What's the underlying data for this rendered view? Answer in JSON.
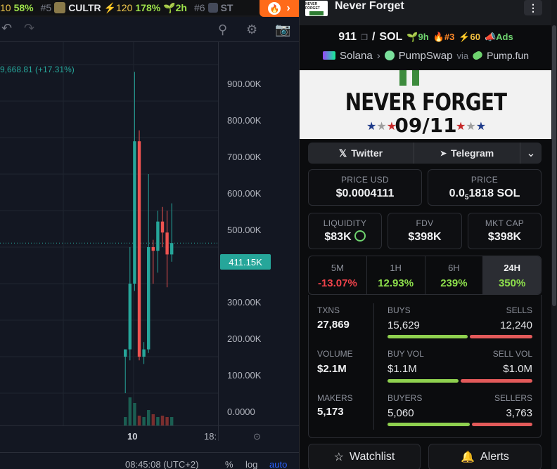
{
  "ticker": {
    "items": [
      {
        "rank": "10",
        "pct": "58%"
      },
      {
        "rank": "#5",
        "sym": "CULTR",
        "boost": "⚡120",
        "pct": "178%",
        "age": "2h"
      },
      {
        "rank": "#6",
        "sym": "ST"
      }
    ]
  },
  "chart": {
    "change_label": "9,668.81 (+17.31%)",
    "yticks": [
      "900.00K",
      "800.00K",
      "700.00K",
      "600.00K",
      "500.00K",
      "300.00K",
      "200.00K",
      "100.00K",
      "0.0000"
    ],
    "current_price": "411.15K",
    "xticks": [
      "10",
      "18:"
    ],
    "status": {
      "time": "08:45:08 (UTC+2)",
      "pct": "%",
      "log": "log",
      "auto": "auto"
    }
  },
  "chart_data": {
    "type": "candlestick",
    "y_unit": "market cap",
    "current": 411150,
    "ylim": [
      0,
      1000000
    ],
    "candles": [
      {
        "o": 100000,
        "h": 120000,
        "l": 0,
        "c": 120000
      },
      {
        "o": 120000,
        "h": 400000,
        "l": 90000,
        "c": 300000
      },
      {
        "o": 300000,
        "h": 880000,
        "l": 280000,
        "c": 690000
      },
      {
        "o": 690000,
        "h": 720000,
        "l": 90000,
        "c": 100000
      },
      {
        "o": 100000,
        "h": 140000,
        "l": 80000,
        "c": 120000
      },
      {
        "o": 120000,
        "h": 600000,
        "l": 110000,
        "c": 400000
      },
      {
        "o": 400000,
        "h": 420000,
        "l": 300000,
        "c": 390000
      },
      {
        "o": 390000,
        "h": 500000,
        "l": 330000,
        "c": 470000
      },
      {
        "o": 470000,
        "h": 510000,
        "l": 400000,
        "c": 440000
      },
      {
        "o": 440000,
        "h": 500000,
        "l": 290000,
        "c": 380000
      },
      {
        "o": 380000,
        "h": 520000,
        "l": 360000,
        "c": 411150
      }
    ],
    "volumes": [
      0.3,
      1,
      0.8,
      0.35,
      0.3,
      0.55,
      0.4,
      0.3,
      0.35,
      0.3,
      0.3
    ]
  },
  "panel": {
    "title": "Never Forget",
    "logo_text": "NEVER FORGET",
    "pair_symbol": "911",
    "pair_quote": "SOL",
    "age": "9h",
    "rank": "#3",
    "boost": "60",
    "ads": "Ads",
    "chain": "Solana",
    "dex": "PumpSwap",
    "via": "via",
    "launchpad": "Pump.fun",
    "banner_title": "NEVER FORGET",
    "banner_date": "09/11",
    "twitter": "Twitter",
    "telegram": "Telegram",
    "price_usd_label": "PRICE USD",
    "price_usd": "$0.0004111",
    "price_label": "PRICE",
    "price_sol_a": "0.0",
    "price_sol_sub": "5",
    "price_sol_b": "1818 SOL",
    "liquidity_label": "LIQUIDITY",
    "liquidity": "$83K",
    "fdv_label": "FDV",
    "fdv": "$398K",
    "mcap_label": "MKT CAP",
    "mcap": "$398K",
    "timeframes": [
      {
        "label": "5M",
        "value": "-13.07%"
      },
      {
        "label": "1H",
        "value": "12.93%"
      },
      {
        "label": "6H",
        "value": "239%"
      },
      {
        "label": "24H",
        "value": "350%"
      }
    ],
    "txns_label": "TXNS",
    "txns": "27,869",
    "buys_label": "BUYS",
    "buys": "15,629",
    "sells_label": "SELLS",
    "sells": "12,240",
    "volume_label": "VOLUME",
    "volume": "$2.1M",
    "buy_vol_label": "BUY VOL",
    "buy_vol": "$1.1M",
    "sell_vol_label": "SELL VOL",
    "sell_vol": "$1.0M",
    "makers_label": "MAKERS",
    "makers": "5,173",
    "buyers_label": "BUYERS",
    "buyers": "5,060",
    "sellers_label": "SELLERS",
    "sellers": "3,763",
    "watchlist": "Watchlist",
    "alerts": "Alerts"
  },
  "colors": {
    "up": "#26a69a",
    "down": "#ef5350",
    "accent": "#ff6b1a"
  }
}
